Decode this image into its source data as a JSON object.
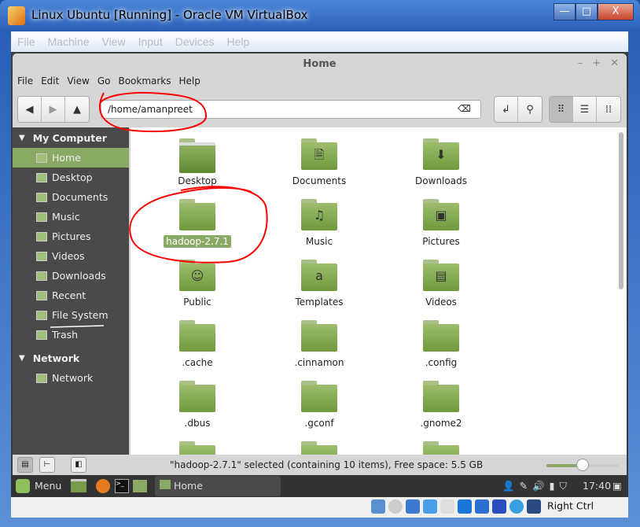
{
  "window": {
    "title": "Linux Ubuntu [Running] - Oracle VM VirtualBox",
    "min": "—",
    "max": "□",
    "close": "X"
  },
  "vbox_menu": [
    "File",
    "Machine",
    "View",
    "Input",
    "Devices",
    "Help"
  ],
  "nemo": {
    "title": "Home",
    "menu": [
      "File",
      "Edit",
      "View",
      "Go",
      "Bookmarks",
      "Help"
    ],
    "location": "/home/amanpreet"
  },
  "sidebar": {
    "sections": [
      {
        "title": "My Computer",
        "items": [
          "Home",
          "Desktop",
          "Documents",
          "Music",
          "Pictures",
          "Videos",
          "Downloads",
          "Recent",
          "File System",
          "Trash"
        ]
      },
      {
        "title": "Network",
        "items": [
          "Network"
        ]
      }
    ]
  },
  "files": [
    {
      "name": "Desktop",
      "type": "desktop"
    },
    {
      "name": "Documents",
      "glyph": "🗎"
    },
    {
      "name": "Downloads",
      "glyph": "⬇"
    },
    {
      "name": "hadoop-2.7.1",
      "selected": true
    },
    {
      "name": "Music",
      "glyph": "♫"
    },
    {
      "name": "Pictures",
      "glyph": "▣"
    },
    {
      "name": "Public",
      "glyph": "☺"
    },
    {
      "name": "Templates",
      "glyph": "a"
    },
    {
      "name": "Videos",
      "glyph": "▤"
    },
    {
      "name": ".cache"
    },
    {
      "name": ".cinnamon"
    },
    {
      "name": ".config"
    },
    {
      "name": ".dbus"
    },
    {
      "name": ".gconf"
    },
    {
      "name": ".gnome2"
    },
    {
      "name": ""
    },
    {
      "name": ""
    },
    {
      "name": ""
    }
  ],
  "status": {
    "message": "\"hadoop-2.7.1\" selected (containing 10 items), Free space: 5.5 GB",
    "zoom_fraction": 0.5
  },
  "panel": {
    "menu": "Menu",
    "task": "Home",
    "clock": "17:40"
  },
  "vbox_status": {
    "host_key": "Right Ctrl"
  },
  "colors": {
    "accent": "#8aa964",
    "annotation": "#ff0000"
  }
}
